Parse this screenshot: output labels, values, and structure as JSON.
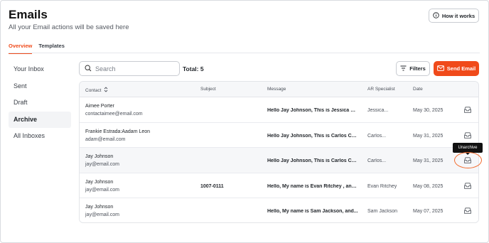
{
  "header": {
    "title": "Emails",
    "subtitle": "All your Email actions will be saved here",
    "how_label": "How it works"
  },
  "tabs": [
    {
      "label": "Overview",
      "active": true
    },
    {
      "label": "Templates",
      "active": false
    }
  ],
  "sidebar": {
    "items": [
      {
        "label": "Your Inbox",
        "active": false
      },
      {
        "label": "Sent",
        "active": false
      },
      {
        "label": "Draft",
        "active": false
      },
      {
        "label": "Archive",
        "active": true
      },
      {
        "label": "All Inboxes",
        "active": false
      }
    ]
  },
  "toolbar": {
    "search_placeholder": "Search",
    "total_label": "Total: 5",
    "filters_label": "Filters",
    "send_label": "Send Email"
  },
  "table": {
    "columns": {
      "contact": "Contact",
      "subject": "Subject",
      "message": "Message",
      "ar": "AR Specialist",
      "date": "Date"
    },
    "rows": [
      {
        "name": "Aimee Porter",
        "email": "contactaimee@email.com",
        "subject": "",
        "message": "Hello Jay Johnson, This is Jessica W...",
        "ar": "Jessica...",
        "date": "May 30, 2025"
      },
      {
        "name": "Frankie Estrada:Aadam Leon",
        "email": "adam@email.com",
        "subject": "",
        "message": "Hello Jay Johnson, This is Carlos Co...",
        "ar": "Carlos...",
        "date": "May 31, 2025"
      },
      {
        "name": "Jay Johnson",
        "email": "jay@email.com",
        "subject": "",
        "message": "Hello Jay Johnson, This is Carlos Co...",
        "ar": "Carlos...",
        "date": "May 31, 2025"
      },
      {
        "name": "Jay Johnson",
        "email": "jay@email.com",
        "subject": "1007-0111",
        "message": "Hello, My name is Evan Ritchey , and...",
        "ar": "Evan Ritchey",
        "date": "May 08, 2025"
      },
      {
        "name": "Jay Johnson",
        "email": "jay@email.com",
        "subject": "",
        "message": "Hello, My name is Sam Jackson, and...",
        "ar": "Sam Jackson",
        "date": "May 07, 2025"
      }
    ]
  },
  "tooltip": {
    "label": "Unarchive"
  },
  "colors": {
    "accent": "#f04a1a",
    "highlight_circle": "#f26b2d"
  }
}
